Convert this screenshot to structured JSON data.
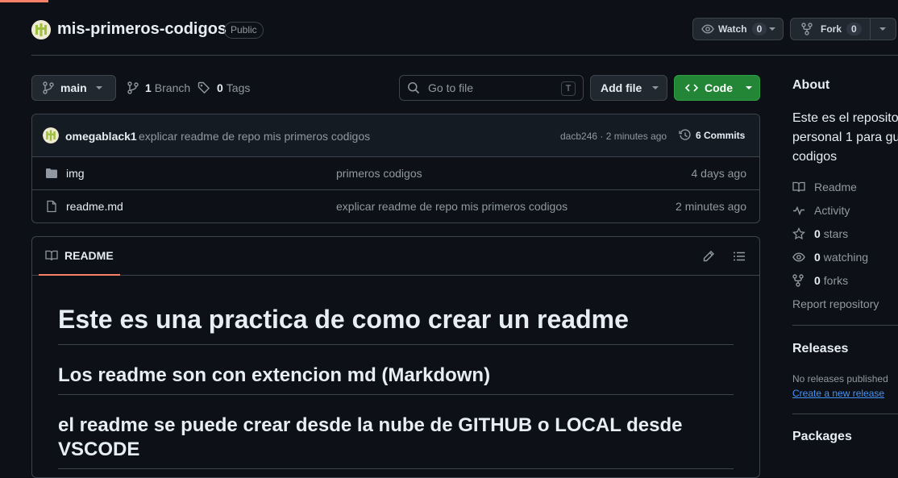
{
  "repo": {
    "name": "mis-primeros-codigos",
    "visibility": "Public",
    "watch_label": "Watch",
    "watch_count": "0",
    "fork_label": "Fork",
    "fork_count": "0"
  },
  "toolbar": {
    "branch": "main",
    "branch_count": "1",
    "branch_label": "Branch",
    "tag_count": "0",
    "tag_label": "Tags",
    "search_placeholder": "Go to file",
    "search_shortcut": "T",
    "add_file_label": "Add file",
    "code_label": "Code"
  },
  "latest_commit": {
    "author": "omegablack1",
    "message": "explicar readme de repo mis primeros codigos",
    "hash_time": "dacb246 · 2 minutes ago",
    "commits_label": "6 Commits"
  },
  "files": [
    {
      "icon": "folder-icon",
      "name": "img",
      "message": "primeros codigos",
      "date": "4 days ago"
    },
    {
      "icon": "file-icon",
      "name": "readme.md",
      "message": "explicar readme de repo mis primeros codigos",
      "date": "2 minutes ago"
    }
  ],
  "readme": {
    "tab_label": "README",
    "h1": "Este es una practica de como crear un readme",
    "h2_1": "Los readme son con extencion md (Markdown)",
    "h2_2": "el readme se puede crear desde la nube de GITHUB o LOCAL desde VSCODE"
  },
  "sidebar": {
    "about_title": "About",
    "about_desc": "Este es el repositor personal 1 para gu codigos",
    "readme_label": "Readme",
    "activity_label": "Activity",
    "stars_count": "0",
    "stars_label": "stars",
    "watching_count": "0",
    "watching_label": "watching",
    "forks_count": "0",
    "forks_label": "forks",
    "report_label": "Report repository",
    "releases_title": "Releases",
    "no_releases": "No releases published",
    "create_release": "Create a new release",
    "packages_title": "Packages"
  },
  "colors": {
    "background": "#0d1117",
    "accent": "#f78166",
    "code_button": "#238636",
    "link": "#4493f8"
  }
}
